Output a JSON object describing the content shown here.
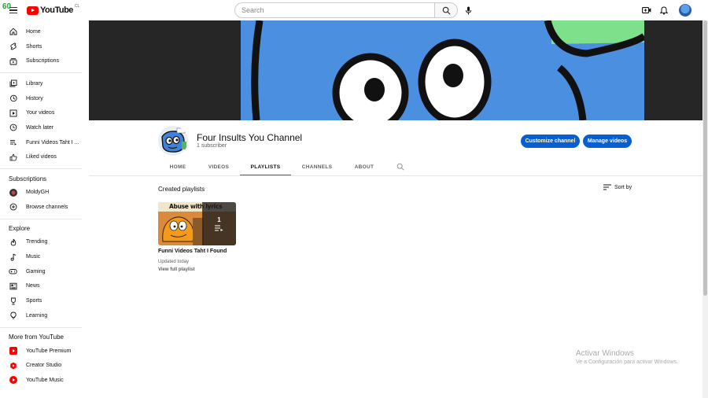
{
  "overlay": {
    "fps": "60"
  },
  "header": {
    "logo_text": "YouTube",
    "logo_region": "CL",
    "search_placeholder": "Search",
    "colors": {
      "brand_red": "#ff0000",
      "accent_blue": "#065fd4"
    }
  },
  "sidebar": {
    "main": [
      {
        "label": "Home",
        "icon": "home-icon"
      },
      {
        "label": "Shorts",
        "icon": "shorts-icon"
      },
      {
        "label": "Subscriptions",
        "icon": "subscriptions-icon"
      }
    ],
    "library": [
      {
        "label": "Library",
        "icon": "library-icon"
      },
      {
        "label": "History",
        "icon": "history-icon"
      },
      {
        "label": "Your videos",
        "icon": "your-videos-icon"
      },
      {
        "label": "Watch later",
        "icon": "watch-later-icon"
      },
      {
        "label": "Funni Videos Taht I ...",
        "icon": "playlist-icon"
      },
      {
        "label": "Liked videos",
        "icon": "thumbs-up-icon"
      }
    ],
    "subscriptions_heading": "Subscriptions",
    "subscriptions": [
      {
        "label": "MoldyGH",
        "icon": "channel-avatar"
      },
      {
        "label": "Browse channels",
        "icon": "plus-circle-icon"
      }
    ],
    "explore_heading": "Explore",
    "explore": [
      {
        "label": "Trending",
        "icon": "fire-icon"
      },
      {
        "label": "Music",
        "icon": "music-note-icon"
      },
      {
        "label": "Gaming",
        "icon": "gamepad-icon"
      },
      {
        "label": "News",
        "icon": "newspaper-icon"
      },
      {
        "label": "Sports",
        "icon": "trophy-icon"
      },
      {
        "label": "Learning",
        "icon": "lightbulb-icon"
      }
    ],
    "more_heading": "More from YouTube",
    "more": [
      {
        "label": "YouTube Premium",
        "icon": "youtube-premium-icon"
      },
      {
        "label": "Creator Studio",
        "icon": "creator-studio-icon"
      },
      {
        "label": "YouTube Music",
        "icon": "youtube-music-icon"
      }
    ]
  },
  "channel": {
    "name": "Four Insults You Channel",
    "subscribers": "1 subscriber",
    "customize_button": "Customize channel",
    "manage_button": "Manage videos",
    "tabs": [
      "HOME",
      "VIDEOS",
      "PLAYLISTS",
      "CHANNELS",
      "ABOUT"
    ],
    "active_tab": "PLAYLISTS"
  },
  "playlists": {
    "section_title": "Created playlists",
    "sort_label": "Sort by",
    "items": [
      {
        "title": "Funni Videos Taht I Found",
        "updated": "Updated today",
        "view_link": "View full playlist",
        "video_count": "1",
        "thumbnail_caption": "Abuse with lyrics"
      }
    ]
  },
  "watermark": {
    "line1": "Activar Windows",
    "line2": "Ve a Configuración para activar Windows."
  }
}
